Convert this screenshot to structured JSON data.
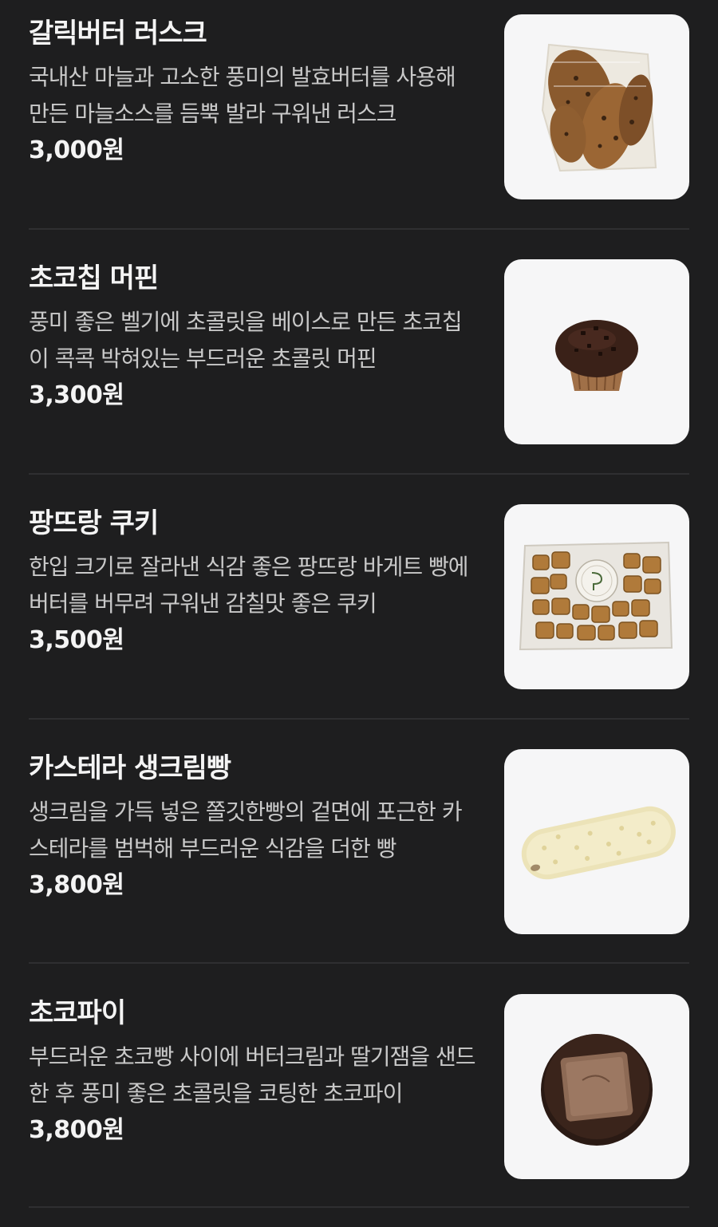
{
  "products": [
    {
      "name": "갈릭버터 러스크",
      "description": "국내산 마늘과 고소한 풍미의 발효버터를 사용해 만든 마늘소스를 듬뿍 발라 구워낸 러스크",
      "price": "3,000원",
      "image_icon": "garlic-butter-rusk-photo"
    },
    {
      "name": "초코칩 머핀",
      "description": "풍미 좋은 벨기에 초콜릿을 베이스로 만든 초코칩이 콕콕 박혀있는 부드러운 초콜릿 머핀",
      "price": "3,300원",
      "image_icon": "chocolate-chip-muffin-photo"
    },
    {
      "name": "팡뜨랑 쿠키",
      "description": "한입 크기로 잘라낸 식감 좋은 팡뜨랑 바게트 빵에 버터를 버무려 구워낸 감칠맛 좋은 쿠키",
      "price": "3,500원",
      "image_icon": "bread-cookie-bag-photo"
    },
    {
      "name": "카스테라 생크림빵",
      "description": "생크림을 가득 넣은 쫄깃한빵의 겉면에 포근한 카스테라를 범벅해 부드러운 식감을 더한 빵",
      "price": "3,800원",
      "image_icon": "castella-cream-bread-photo"
    },
    {
      "name": "초코파이",
      "description": "부드러운 초코빵 사이에 버터크림과 딸기잼을 샌드한 후 풍미 좋은 초콜릿을 코팅한 초코파이",
      "price": "3,800원",
      "image_icon": "choco-pie-photo"
    }
  ]
}
